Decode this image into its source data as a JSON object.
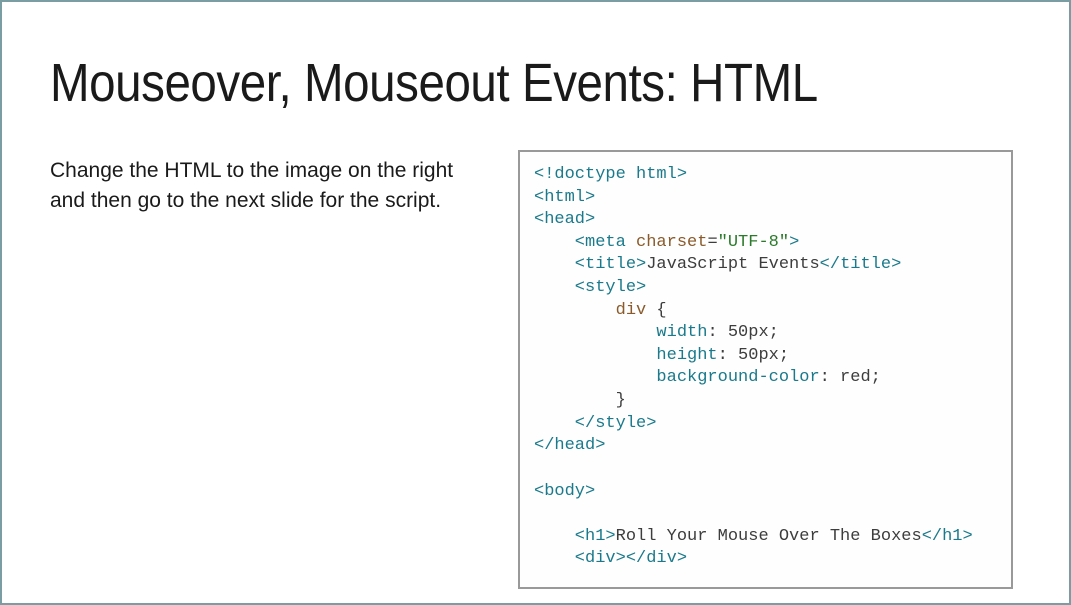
{
  "slide": {
    "title": "Mouseover, Mouseout Events: HTML",
    "instruction": "Change the HTML to the image on the right and then go to the next slide for the script."
  },
  "code": {
    "l1": "<!doctype html>",
    "l2": "<html>",
    "l3": "<head>",
    "l4a": "    <",
    "l4b": "meta",
    "l4c": " charset",
    "l4d": "=",
    "l4e": "\"UTF-8\"",
    "l4f": ">",
    "l5a": "    <",
    "l5b": "title",
    "l5c": ">",
    "l5d": "JavaScript Events",
    "l5e": "</",
    "l5f": "title",
    "l5g": ">",
    "l6a": "    <",
    "l6b": "style",
    "l6c": ">",
    "l7a": "        ",
    "l7b": "div",
    "l7c": " {",
    "l8a": "            ",
    "l8b": "width",
    "l8c": ": 50px;",
    "l9a": "            ",
    "l9b": "height",
    "l9c": ": 50px;",
    "l10a": "            ",
    "l10b": "background-color",
    "l10c": ": red;",
    "l11": "        }",
    "l12a": "    </",
    "l12b": "style",
    "l12c": ">",
    "l13a": "</",
    "l13b": "head",
    "l13c": ">",
    "l14": "",
    "l15a": "<",
    "l15b": "body",
    "l15c": ">",
    "l16": "",
    "l17a": "    <",
    "l17b": "h1",
    "l17c": ">",
    "l17d": "Roll Your Mouse Over The Boxes",
    "l17e": "</",
    "l17f": "h1",
    "l17g": ">",
    "l18a": "    <",
    "l18b": "div",
    "l18c": "></",
    "l18d": "div",
    "l18e": ">"
  }
}
